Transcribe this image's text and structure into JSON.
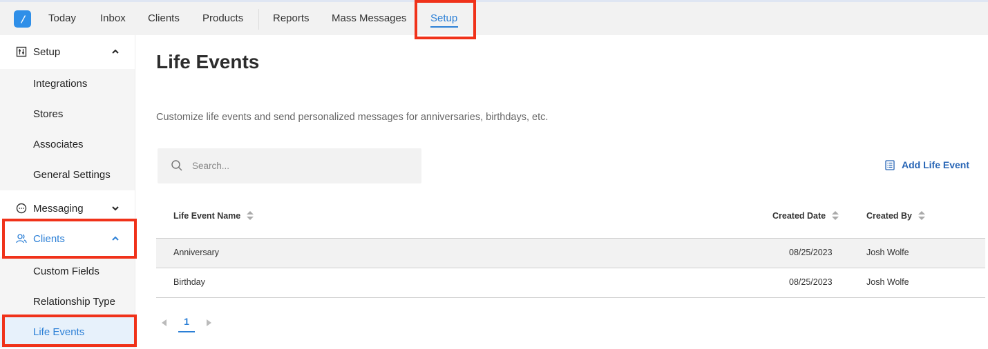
{
  "nav": {
    "items": [
      {
        "label": "Today"
      },
      {
        "label": "Inbox"
      },
      {
        "label": "Clients"
      },
      {
        "label": "Products"
      },
      {
        "label": "Reports"
      },
      {
        "label": "Mass Messages"
      },
      {
        "label": "Setup",
        "active": true
      }
    ]
  },
  "sidebar": {
    "setup": {
      "label": "Setup",
      "icon": "settings-sliders-icon",
      "expanded": true
    },
    "setup_items": [
      {
        "label": "Integrations"
      },
      {
        "label": "Stores"
      },
      {
        "label": "Associates"
      },
      {
        "label": "General Settings"
      }
    ],
    "messaging": {
      "label": "Messaging",
      "icon": "chat-bubble-icon",
      "expanded": false
    },
    "clients": {
      "label": "Clients",
      "icon": "users-icon",
      "expanded": true
    },
    "clients_items": [
      {
        "label": "Custom Fields"
      },
      {
        "label": "Relationship Type"
      },
      {
        "label": "Life Events",
        "active": true
      }
    ]
  },
  "main": {
    "title": "Life Events",
    "subtitle": "Customize life events and send personalized messages for anniversaries, birthdays, etc.",
    "search_placeholder": "Search...",
    "add_button": "Add Life Event",
    "columns": {
      "name": "Life Event Name",
      "created_date": "Created Date",
      "created_by": "Created By"
    },
    "rows": [
      {
        "name": "Anniversary",
        "created_date": "08/25/2023",
        "created_by": "Josh Wolfe"
      },
      {
        "name": "Birthday",
        "created_date": "08/25/2023",
        "created_by": "Josh Wolfe"
      }
    ],
    "pagination": {
      "current_page": "1"
    }
  },
  "colors": {
    "accent": "#2b7fd6",
    "add_button": "#2664b5",
    "highlight_box": "#f0321a",
    "active_bg": "#e7f1fb"
  }
}
